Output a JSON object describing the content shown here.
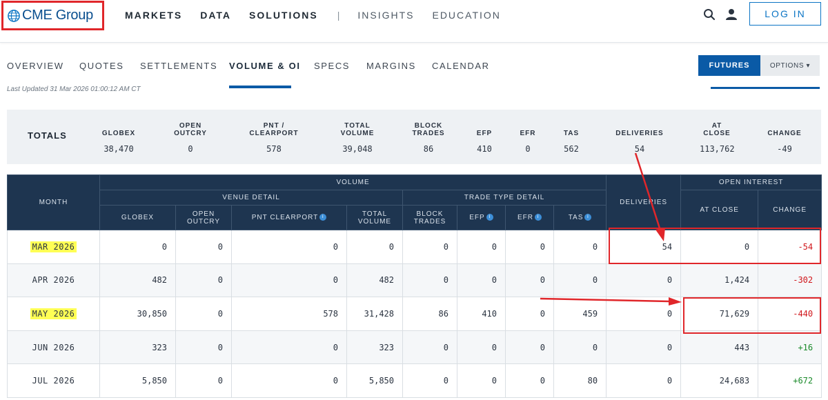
{
  "header": {
    "logo_text": "CME Group",
    "nav": [
      "MARKETS",
      "DATA",
      "SOLUTIONS"
    ],
    "separator": "|",
    "nav_secondary": [
      "INSIGHTS",
      "EDUCATION"
    ],
    "login_label": "LOG IN"
  },
  "tabs": {
    "items": [
      "OVERVIEW",
      "QUOTES",
      "SETTLEMENTS",
      "VOLUME & OI",
      "SPECS",
      "MARGINS",
      "CALENDAR"
    ],
    "active": "VOLUME & OI",
    "futures_label": "FUTURES",
    "options_label": "OPTIONS ▾"
  },
  "last_updated": "Last Updated 31 Mar 2026 01:00:12 AM CT",
  "totals": {
    "label": "TOTALS",
    "columns": [
      {
        "header": "GLOBEX",
        "value": "38,470"
      },
      {
        "header": "OPEN OUTCRY",
        "value": "0"
      },
      {
        "header": "PNT / CLEARPORT",
        "value": "578"
      },
      {
        "header": "TOTAL VOLUME",
        "value": "39,048"
      },
      {
        "header": "BLOCK TRADES",
        "value": "86"
      },
      {
        "header": "EFP",
        "value": "410"
      },
      {
        "header": "EFR",
        "value": "0"
      },
      {
        "header": "TAS",
        "value": "562"
      },
      {
        "header": "DELIVERIES",
        "value": "54"
      },
      {
        "header": "AT CLOSE",
        "value": "113,762"
      },
      {
        "header": "CHANGE",
        "value": "-49"
      }
    ]
  },
  "table": {
    "group_headers": {
      "month": "MONTH",
      "volume": "VOLUME",
      "venue_detail": "VENUE DETAIL",
      "trade_type_detail": "TRADE TYPE DETAIL",
      "deliveries": "DELIVERIES",
      "open_interest": "OPEN INTEREST"
    },
    "columns": [
      "GLOBEX",
      "OPEN OUTCRY",
      "PNT CLEARPORT",
      "TOTAL VOLUME",
      "BLOCK TRADES",
      "EFP",
      "EFR",
      "TAS",
      "AT CLOSE",
      "CHANGE"
    ],
    "info_icon": "i",
    "rows": [
      {
        "month": "MAR 2026",
        "highlight": true,
        "globex": "0",
        "open_outcry": "0",
        "pnt_clearport": "0",
        "total_volume": "0",
        "block_trades": "0",
        "efp": "0",
        "efr": "0",
        "tas": "0",
        "deliveries": "54",
        "at_close": "0",
        "change": "-54",
        "change_sign": "neg"
      },
      {
        "month": "APR 2026",
        "highlight": false,
        "globex": "482",
        "open_outcry": "0",
        "pnt_clearport": "0",
        "total_volume": "482",
        "block_trades": "0",
        "efp": "0",
        "efr": "0",
        "tas": "0",
        "deliveries": "0",
        "at_close": "1,424",
        "change": "-302",
        "change_sign": "neg"
      },
      {
        "month": "MAY 2026",
        "highlight": true,
        "globex": "30,850",
        "open_outcry": "0",
        "pnt_clearport": "578",
        "total_volume": "31,428",
        "block_trades": "86",
        "efp": "410",
        "efr": "0",
        "tas": "459",
        "deliveries": "0",
        "at_close": "71,629",
        "change": "-440",
        "change_sign": "neg"
      },
      {
        "month": "JUN 2026",
        "highlight": false,
        "globex": "323",
        "open_outcry": "0",
        "pnt_clearport": "0",
        "total_volume": "323",
        "block_trades": "0",
        "efp": "0",
        "efr": "0",
        "tas": "0",
        "deliveries": "0",
        "at_close": "443",
        "change": "+16",
        "change_sign": "pos"
      },
      {
        "month": "JUL 2026",
        "highlight": false,
        "globex": "5,850",
        "open_outcry": "0",
        "pnt_clearport": "0",
        "total_volume": "5,850",
        "block_trades": "0",
        "efp": "0",
        "efr": "0",
        "tas": "80",
        "deliveries": "0",
        "at_close": "24,683",
        "change": "+672",
        "change_sign": "pos"
      }
    ]
  },
  "colors": {
    "brand_blue": "#0a5aa6",
    "header_navy": "#1e3550",
    "annotation_red": "#e0262a",
    "highlight_yellow": "#ffff55",
    "negative_red": "#d0161b",
    "positive_green": "#1a8a2a"
  },
  "icons": {
    "logo": "globe-icon",
    "search": "search-icon",
    "user": "user-icon",
    "info": "info-icon"
  }
}
